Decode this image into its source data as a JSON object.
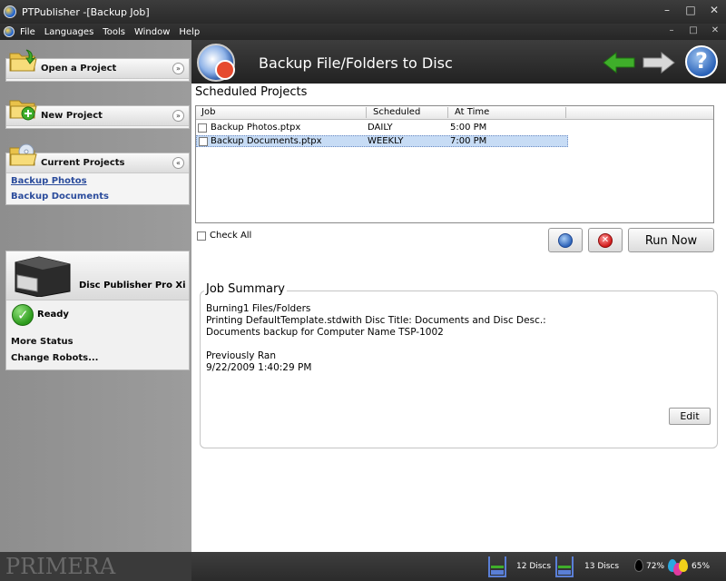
{
  "window": {
    "title": "PTPublisher -[Backup Job]",
    "controls": [
      "–",
      "□",
      "✕"
    ]
  },
  "menu": {
    "items": [
      "File",
      "Languages",
      "Tools",
      "Window",
      "Help"
    ],
    "controls": [
      "–",
      "□",
      "✕"
    ]
  },
  "sidebar": {
    "panels": [
      {
        "label": "Open a Project",
        "chevron": "»"
      },
      {
        "label": "New Project",
        "chevron": "»"
      },
      {
        "label": "Current Projects",
        "chevron": "«"
      }
    ],
    "current_projects": [
      "Backup Photos",
      "Backup Documents"
    ],
    "printer": {
      "name": "Disc Publisher Pro Xi",
      "status": "Ready",
      "links": [
        "More Status",
        "Change Robots..."
      ]
    },
    "brand": "PRIMERA"
  },
  "main": {
    "title": "Backup File/Folders to Disc",
    "scheduled_label": "Scheduled Projects",
    "columns": [
      "Job",
      "Scheduled",
      "At Time"
    ],
    "rows": [
      {
        "job": "Backup Photos.ptpx",
        "scheduled": "DAILY",
        "time": "5:00 PM",
        "selected": false
      },
      {
        "job": "Backup Documents.ptpx",
        "scheduled": "WEEKLY",
        "time": "7:00 PM",
        "selected": true
      }
    ],
    "check_all_label": "Check All",
    "run_now_label": "Run Now",
    "summary": {
      "title": "Job Summary",
      "lines": [
        "Burning1 Files/Folders",
        "Printing DefaultTemplate.stdwith Disc Title: Documents and Disc Desc.:",
        "Documents backup for Computer Name TSP-1002",
        "",
        "Previously Ran",
        "9/22/2009 1:40:29 PM"
      ],
      "edit_label": "Edit"
    }
  },
  "status": {
    "bin1_discs": "12 Discs",
    "bin2_discs": "13 Discs",
    "ink_black": "72%",
    "ink_color": "65%"
  },
  "colors": {
    "accent_blue": "#2a62b8",
    "selection": "#c7dcf5",
    "link": "#2b4c9c",
    "nav_green": "#3fae2a"
  }
}
